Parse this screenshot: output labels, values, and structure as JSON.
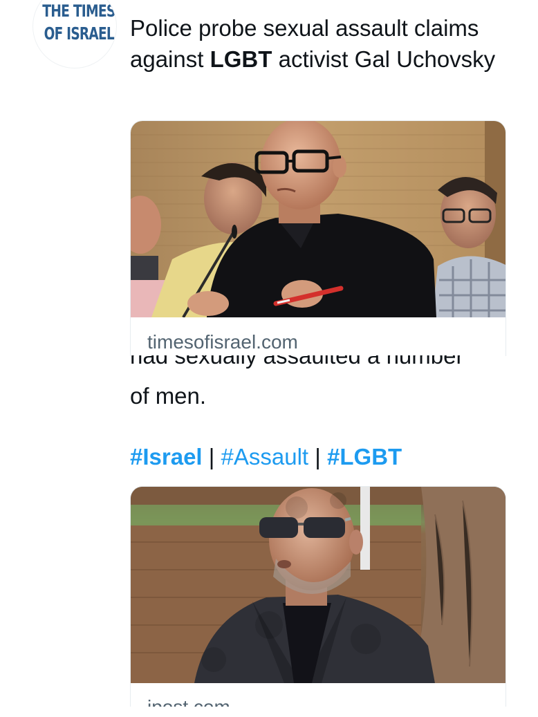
{
  "tweet": {
    "avatar": {
      "icon": "times-of-israel-logo",
      "line1": "THE TIMES",
      "line2": "OF ISRAEL"
    },
    "headline_before": "Police probe sexual assault claims against ",
    "headline_bold": "LGBT",
    "headline_after": " activist Gal Uchovsky",
    "card1": {
      "domain": "timesofisrael.com",
      "image": "man-with-glasses-speaking-at-microphone"
    },
    "overlap_text": "had sexually assaulted a number",
    "body_line": "of men.",
    "hashtags": [
      {
        "text": "#Israel",
        "bold": true
      },
      {
        "text": "#Assault",
        "bold": false
      },
      {
        "text": "#LGBT",
        "bold": true
      }
    ],
    "separator": "|",
    "card2": {
      "domain": "jpost.com",
      "image": "man-with-sunglasses-outdoors"
    }
  },
  "colors": {
    "link": "#1d9bf0",
    "text": "#0f1419",
    "muted": "#536471",
    "logo": "#2a5d8f"
  }
}
